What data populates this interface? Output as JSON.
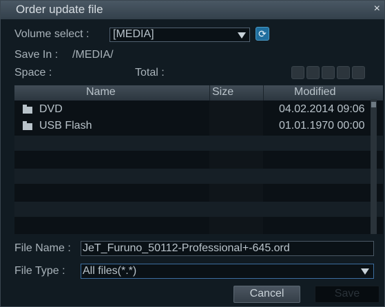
{
  "dialog": {
    "title": "Order update file",
    "close_glyph": "×"
  },
  "volume": {
    "label": "Volume select :",
    "value": "[MEDIA]",
    "refresh_icon": "refresh-icon"
  },
  "save_in": {
    "label": "Save In :",
    "value": "/MEDIA/"
  },
  "space": {
    "label": "Space :",
    "total_label": "Total :"
  },
  "table": {
    "columns": [
      "Name",
      "Size",
      "Modified"
    ],
    "rows": [
      {
        "name": "DVD",
        "size": "",
        "modified": "04.02.2014 09:06"
      },
      {
        "name": "USB Flash",
        "size": "",
        "modified": "01.01.1970 00:00"
      }
    ]
  },
  "file_name": {
    "label": "File Name :",
    "value": "JeT_Furuno_50112-Professional+-645.ord"
  },
  "file_type": {
    "label": "File Type :",
    "value": "All files(*.*)"
  },
  "buttons": {
    "cancel": "Cancel",
    "save": "Save"
  },
  "colors": {
    "background": "#111b22",
    "titlebar": "#3e4b56",
    "accent": "#1f6e9e"
  }
}
